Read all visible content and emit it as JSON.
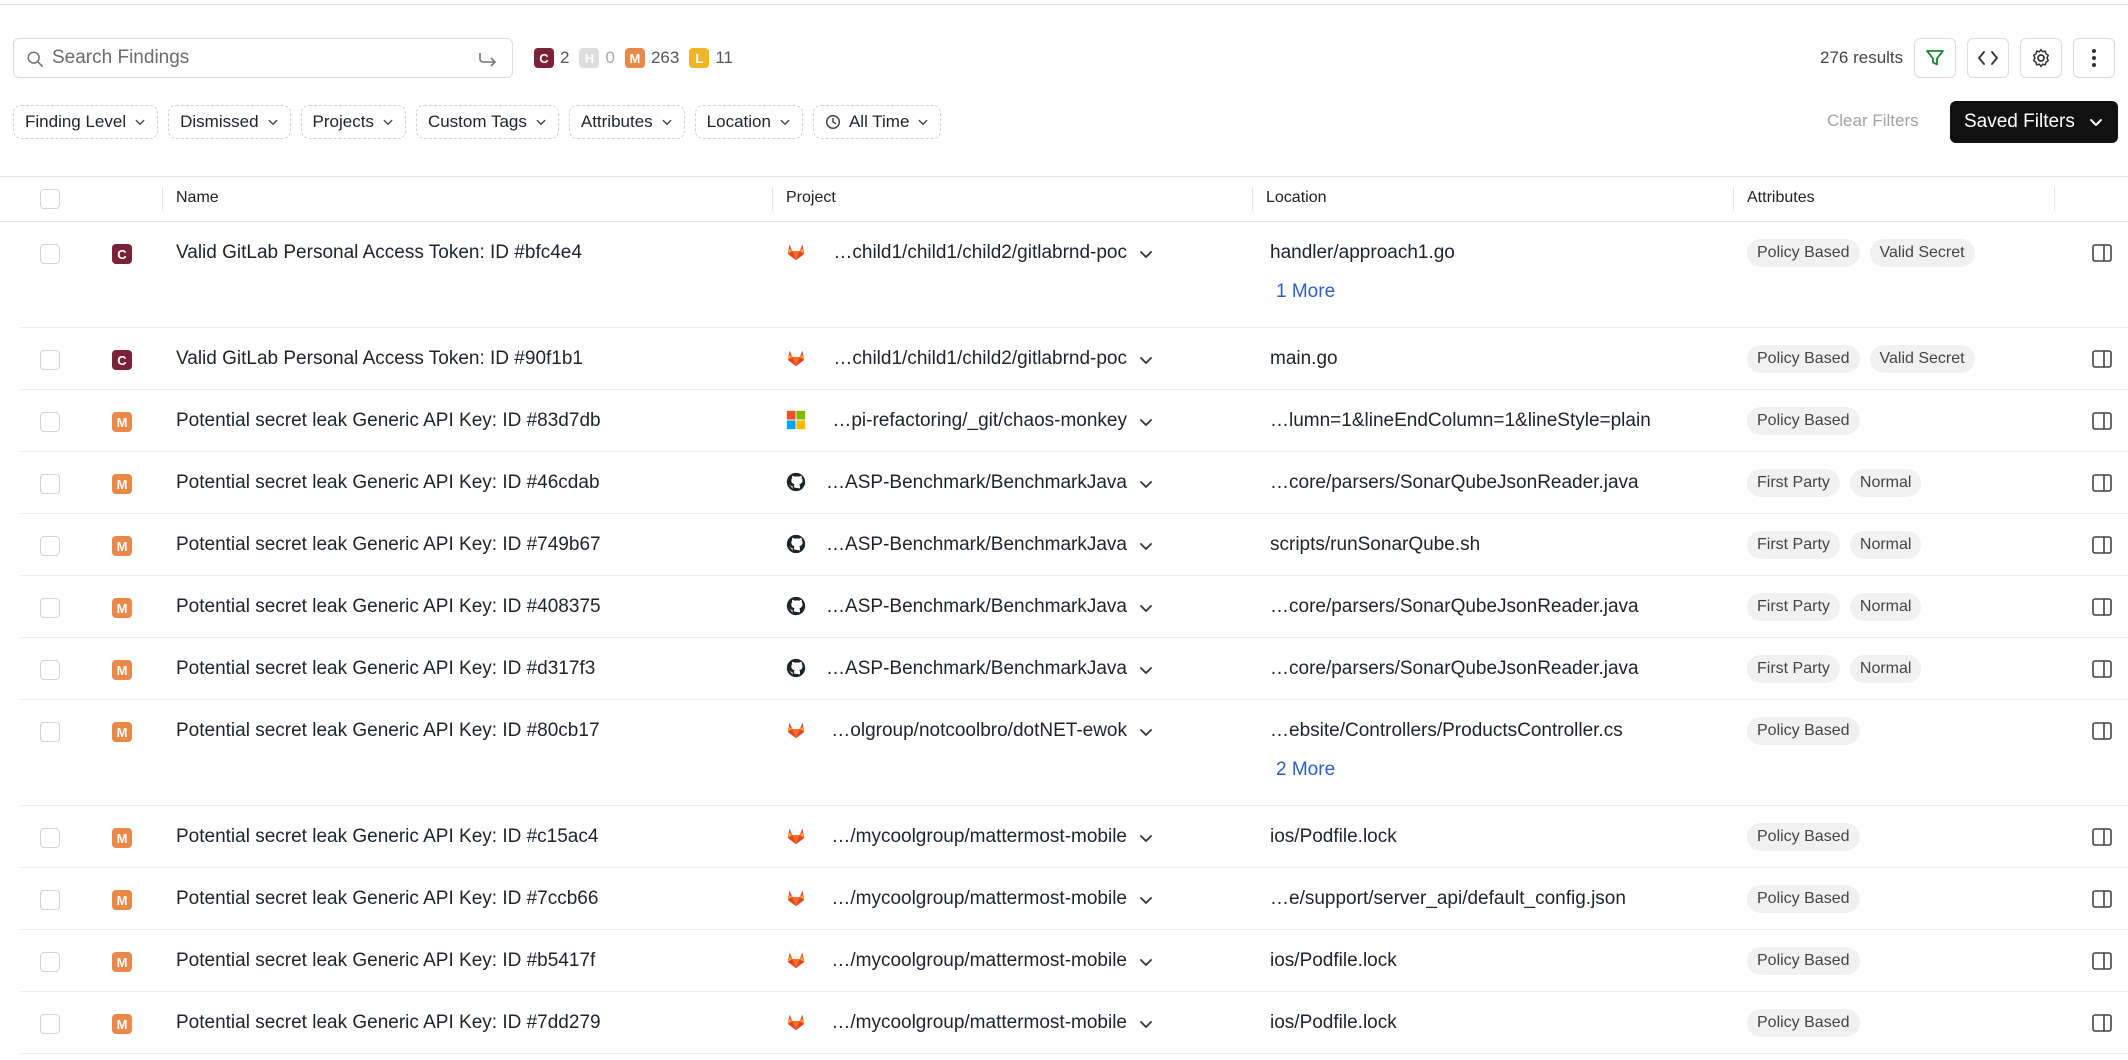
{
  "search": {
    "placeholder": "Search Findings"
  },
  "severity_counts": [
    {
      "letter": "C",
      "count": "2",
      "color": "#7a2236"
    },
    {
      "letter": "H",
      "count": "0",
      "color": "#dedede"
    },
    {
      "letter": "M",
      "count": "263",
      "color": "#e8894a"
    },
    {
      "letter": "L",
      "count": "11",
      "color": "#f0b429"
    }
  ],
  "results": "276 results",
  "toolbar": {
    "filter_icon": "filter-icon",
    "code_icon": "code-icon",
    "settings_icon": "gear-icon",
    "more_icon": "more-vertical-icon"
  },
  "filters": [
    {
      "label": "Finding Level"
    },
    {
      "label": "Dismissed"
    },
    {
      "label": "Projects"
    },
    {
      "label": "Custom Tags"
    },
    {
      "label": "Attributes"
    },
    {
      "label": "Location"
    },
    {
      "label": "All Time"
    }
  ],
  "clear_filters": "Clear Filters",
  "saved_filters": "Saved Filters",
  "columns": {
    "name": "Name",
    "project": "Project",
    "location": "Location",
    "attributes": "Attributes"
  },
  "colors": {
    "critical": "#7a2236",
    "medium": "#e8894a",
    "link": "#2f5fbf"
  },
  "rows": [
    {
      "level": "C",
      "name": "Valid GitLab Personal Access Token: ID #bfc4e4",
      "project_icon": "gitlab-icon",
      "project": "…child1/child1/child2/gitlabrnd-poc",
      "location": "handler/approach1.go",
      "more": "1 More",
      "attributes": [
        "Policy Based",
        "Valid Secret"
      ]
    },
    {
      "level": "C",
      "name": "Valid GitLab Personal Access Token: ID #90f1b1",
      "project_icon": "gitlab-icon",
      "project": "…child1/child1/child2/gitlabrnd-poc",
      "location": "main.go",
      "more": "",
      "attributes": [
        "Policy Based",
        "Valid Secret"
      ]
    },
    {
      "level": "M",
      "name": "Potential secret leak Generic API Key: ID #83d7db",
      "project_icon": "microsoft-icon",
      "project": "…pi-refactoring/_git/chaos-monkey",
      "location": "…lumn=1&lineEndColumn=1&lineStyle=plain",
      "more": "",
      "attributes": [
        "Policy Based"
      ]
    },
    {
      "level": "M",
      "name": "Potential secret leak Generic API Key: ID #46cdab",
      "project_icon": "github-icon",
      "project": "…ASP-Benchmark/BenchmarkJava",
      "location": "…core/parsers/SonarQubeJsonReader.java",
      "more": "",
      "attributes": [
        "First Party",
        "Normal"
      ]
    },
    {
      "level": "M",
      "name": "Potential secret leak Generic API Key: ID #749b67",
      "project_icon": "github-icon",
      "project": "…ASP-Benchmark/BenchmarkJava",
      "location": "scripts/runSonarQube.sh",
      "more": "",
      "attributes": [
        "First Party",
        "Normal"
      ]
    },
    {
      "level": "M",
      "name": "Potential secret leak Generic API Key: ID #408375",
      "project_icon": "github-icon",
      "project": "…ASP-Benchmark/BenchmarkJava",
      "location": "…core/parsers/SonarQubeJsonReader.java",
      "more": "",
      "attributes": [
        "First Party",
        "Normal"
      ]
    },
    {
      "level": "M",
      "name": "Potential secret leak Generic API Key: ID #d317f3",
      "project_icon": "github-icon",
      "project": "…ASP-Benchmark/BenchmarkJava",
      "location": "…core/parsers/SonarQubeJsonReader.java",
      "more": "",
      "attributes": [
        "First Party",
        "Normal"
      ]
    },
    {
      "level": "M",
      "name": "Potential secret leak Generic API Key: ID #80cb17",
      "project_icon": "gitlab-icon",
      "project": "…olgroup/notcoolbro/dotNET-ewok",
      "location": "…ebsite/Controllers/ProductsController.cs",
      "more": "2 More",
      "attributes": [
        "Policy Based"
      ]
    },
    {
      "level": "M",
      "name": "Potential secret leak Generic API Key: ID #c15ac4",
      "project_icon": "gitlab-icon",
      "project": "…/mycoolgroup/mattermost-mobile",
      "location": "ios/Podfile.lock",
      "more": "",
      "attributes": [
        "Policy Based"
      ]
    },
    {
      "level": "M",
      "name": "Potential secret leak Generic API Key: ID #7ccb66",
      "project_icon": "gitlab-icon",
      "project": "…/mycoolgroup/mattermost-mobile",
      "location": "…e/support/server_api/default_config.json",
      "more": "",
      "attributes": [
        "Policy Based"
      ]
    },
    {
      "level": "M",
      "name": "Potential secret leak Generic API Key: ID #b5417f",
      "project_icon": "gitlab-icon",
      "project": "…/mycoolgroup/mattermost-mobile",
      "location": "ios/Podfile.lock",
      "more": "",
      "attributes": [
        "Policy Based"
      ]
    },
    {
      "level": "M",
      "name": "Potential secret leak Generic API Key: ID #7dd279",
      "project_icon": "gitlab-icon",
      "project": "…/mycoolgroup/mattermost-mobile",
      "location": "ios/Podfile.lock",
      "more": "",
      "attributes": [
        "Policy Based"
      ]
    }
  ]
}
